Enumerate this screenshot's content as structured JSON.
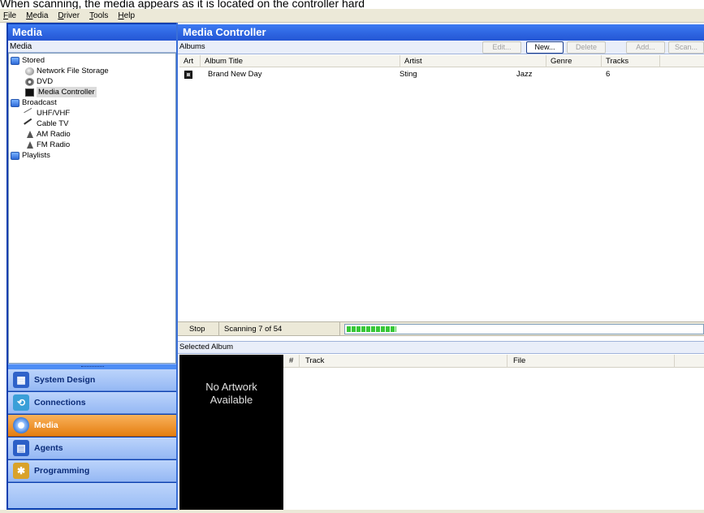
{
  "caption": "When scanning, the media appears as it is located on the controller hard",
  "menu": [
    "File",
    "Media",
    "Driver",
    "Tools",
    "Help"
  ],
  "left": {
    "title": "Media",
    "subtitle": "Media",
    "tree": {
      "stored": "Stored",
      "network": "Network File Storage",
      "dvd": "DVD",
      "media_controller": "Media Controller",
      "broadcast": "Broadcast",
      "uhf": "UHF/VHF",
      "cable": "Cable TV",
      "am": "AM Radio",
      "fm": "FM Radio",
      "playlists": "Playlists"
    },
    "nav": {
      "system_design": "System Design",
      "connections": "Connections",
      "media": "Media",
      "agents": "Agents",
      "programming": "Programming"
    }
  },
  "right": {
    "title": "Media Controller",
    "albums_label": "Albums",
    "buttons": {
      "edit": "Edit...",
      "new": "New...",
      "delete": "Delete",
      "add": "Add...",
      "scan": "Scan..."
    },
    "columns": {
      "art": "Art",
      "album_title": "Album Title",
      "artist": "Artist",
      "genre": "Genre",
      "tracks": "Tracks"
    },
    "albums": [
      {
        "title": "Brand New Day",
        "artist": "Sting",
        "genre": "Jazz",
        "tracks": "6"
      }
    ],
    "status": {
      "stop": "Stop",
      "scanning": "Scanning 7 of 54",
      "progress": 0.14
    },
    "selected_album_label": "Selected Album",
    "artwork_text_line1": "No Artwork",
    "artwork_text_line2": "Available",
    "track_columns": {
      "number": "#",
      "track": "Track",
      "file": "File"
    }
  }
}
